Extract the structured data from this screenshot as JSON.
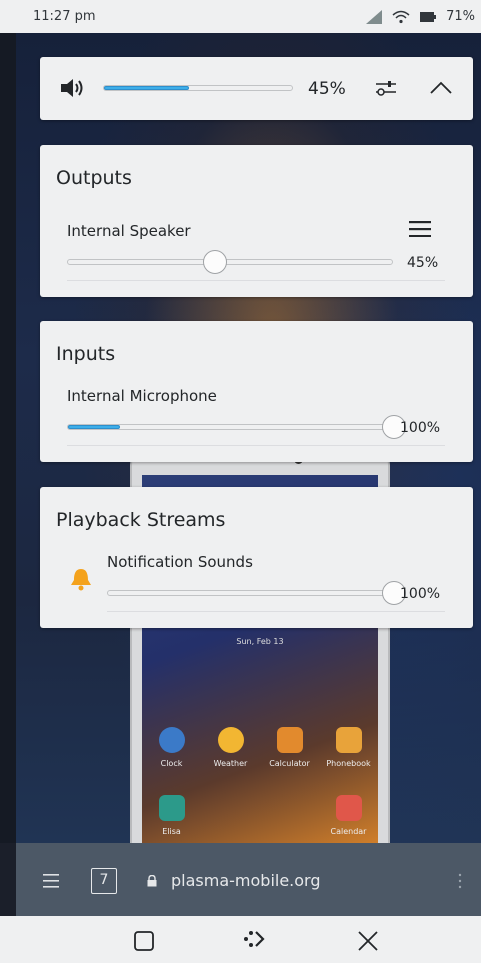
{
  "status_bar": {
    "time": "11:27 pm",
    "battery_percent": "71%"
  },
  "volume_header": {
    "level_percent": "45%",
    "level_value": 45
  },
  "outputs": {
    "title": "Outputs",
    "device_label": "Internal Speaker",
    "level_percent": "45%",
    "level_value": 45
  },
  "inputs": {
    "title": "Inputs",
    "device_label": "Internal Microphone",
    "level_percent": "100%",
    "level_value": 100
  },
  "playback_streams": {
    "title": "Playback Streams",
    "stream_label": "Notification Sounds",
    "level_percent": "100%",
    "level_value": 100
  },
  "background_phone": {
    "date": "Sun, Feb 13",
    "apps": [
      "Clock",
      "Weather",
      "Calculator",
      "Phonebook",
      "Elisa",
      "Calendar"
    ]
  },
  "browser_bar": {
    "tab_count": "7",
    "url": "plasma-mobile.org"
  },
  "colors": {
    "accent": "#3daee9",
    "panel": "#eff0f1",
    "text": "#232629",
    "bell": "#f4a21c"
  },
  "icons": [
    "speaker-icon",
    "mixer-settings-icon",
    "collapse-chevron-icon",
    "hamburger-menu-icon",
    "bell-icon",
    "lock-icon",
    "overview-square-icon",
    "home-icon",
    "close-icon",
    "wifi-icon",
    "signal-icon",
    "battery-icon"
  ]
}
